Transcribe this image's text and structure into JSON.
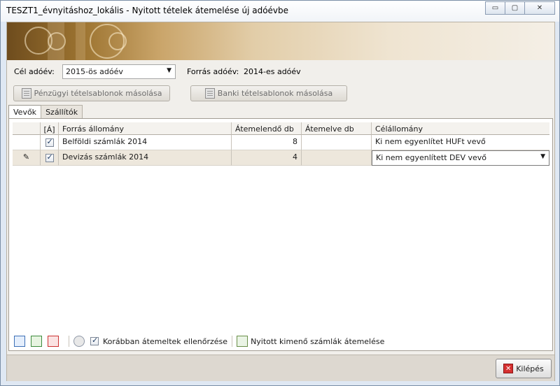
{
  "window": {
    "title": "TESZT1_évnyitáshoz_lokális - Nyitott tételek átemelése új adóévbe",
    "minimize_glyph": "▭",
    "maximize_glyph": "▢",
    "close_glyph": "✕"
  },
  "form": {
    "target_year_label": "Cél adóév:",
    "target_year_value": "2015-ös adóév",
    "source_year_label": "Forrás adóév:",
    "source_year_value": "2014-es adóév",
    "copy_financial_label": "Pénzügyi tételsablonok másolása",
    "copy_bank_label": "Banki tételsablonok másolása"
  },
  "tabs": [
    {
      "label": "Vevők"
    },
    {
      "label": "Szállítók"
    }
  ],
  "grid": {
    "columns": [
      "",
      "[Á]",
      "Forrás állomány",
      "Átemelendő db",
      "Átemelve db",
      "Célállomány"
    ],
    "rows": [
      {
        "indicator": "",
        "checked": true,
        "source": "Belföldi számlák 2014",
        "to_transfer": "8",
        "transferred": "",
        "target": "Ki nem egyenlítet HUFt vevő"
      },
      {
        "indicator": "✎",
        "checked": true,
        "source": "Devizás számlák 2014",
        "to_transfer": "4",
        "transferred": "",
        "target": "Ki nem egyenlített DEV vevő"
      }
    ]
  },
  "toolbar": {
    "check_previous_label": "Korábban átemeltek ellenőrzése",
    "transfer_outgoing_label": "Nyitott kimenő számlák átemelése"
  },
  "footer": {
    "exit_label": "Kilépés"
  }
}
